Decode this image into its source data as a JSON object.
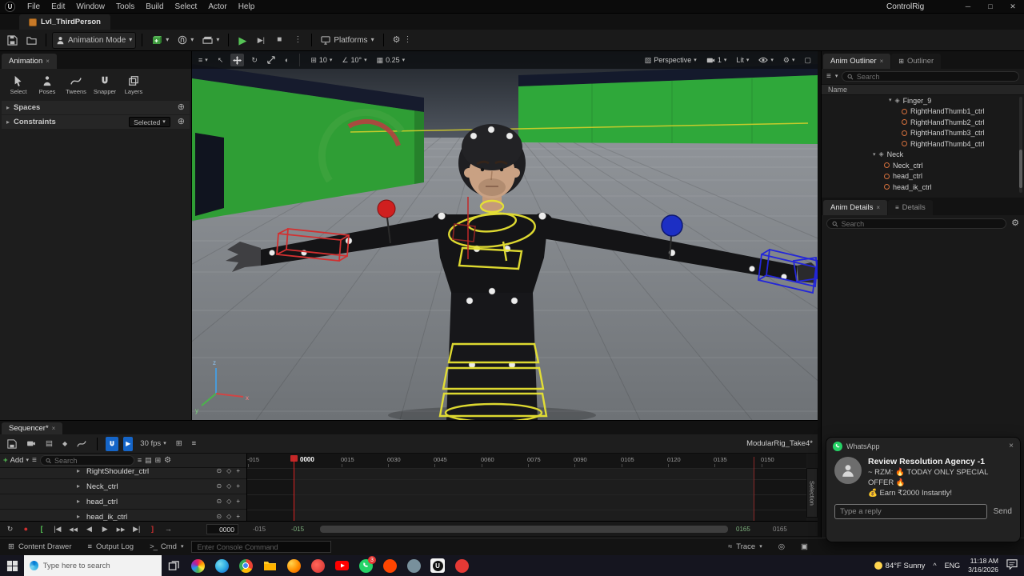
{
  "colors": {
    "accent_blue": "#1565c8",
    "play_green": "#56c356",
    "wall_green": "#2fa238",
    "control_yellow": "#e8e332",
    "control_red": "#d83030",
    "control_blue": "#2430d0",
    "whatsapp_green": "#25d366"
  },
  "menu": {
    "items": [
      "File",
      "Edit",
      "Window",
      "Tools",
      "Build",
      "Select",
      "Actor",
      "Help"
    ],
    "window_title": "ControlRig"
  },
  "tabs": {
    "level_tab": "Lvl_ThirdPerson"
  },
  "toolbar": {
    "mode": "Animation Mode",
    "platforms": "Platforms"
  },
  "anim_panel": {
    "title": "Animation",
    "tools": [
      {
        "label": "Select"
      },
      {
        "label": "Poses"
      },
      {
        "label": "Tweens"
      },
      {
        "label": "Snapper"
      },
      {
        "label": "Layers"
      }
    ],
    "spaces_label": "Spaces",
    "constraints_label": "Constraints",
    "constraints_value": "Selected"
  },
  "viewport": {
    "snap_move": "10",
    "snap_rotate": "10°",
    "snap_scale": "0.25",
    "perspective_label": "Perspective",
    "camera_speed": "1",
    "view_mode_label": "Lit",
    "axis_x": "x",
    "axis_y": "y",
    "axis_z": "z"
  },
  "outliner": {
    "tab_active": "Anim Outliner",
    "tab_inactive": "Outliner",
    "search_placeholder": "Search",
    "name_header": "Name",
    "tree": [
      {
        "label": "Finger_9",
        "type": "group"
      },
      {
        "label": "RightHandThumb1_ctrl",
        "type": "control"
      },
      {
        "label": "RightHandThumb2_ctrl",
        "type": "control"
      },
      {
        "label": "RightHandThumb3_ctrl",
        "type": "control"
      },
      {
        "label": "RightHandThumb4_ctrl",
        "type": "control"
      },
      {
        "label": "Neck",
        "type": "group"
      },
      {
        "label": "Neck_ctrl",
        "type": "control"
      },
      {
        "label": "head_ctrl",
        "type": "control"
      },
      {
        "label": "head_ik_ctrl",
        "type": "control"
      }
    ]
  },
  "details_panel": {
    "tab_active": "Anim Details",
    "tab_inactive": "Details",
    "search_placeholder": "Search"
  },
  "sequencer": {
    "tab_title": "Sequencer*",
    "fps_label": "30 fps",
    "take_name": "ModularRig_Take4*",
    "add_label": "Add",
    "search_placeholder": "Search",
    "tracks": [
      {
        "label": "RightShoulder_ctrl"
      },
      {
        "label": "Neck_ctrl"
      },
      {
        "label": "head_ctrl"
      },
      {
        "label": "head_ik_ctrl"
      }
    ],
    "playhead_label": "0000",
    "ruler_ticks": [
      "-015",
      "0015",
      "0030",
      "0045",
      "0060",
      "0075",
      "0090",
      "0105",
      "0120",
      "0135",
      "0150"
    ],
    "current_frame": "0000",
    "view_start": "-015",
    "range_start": "-015",
    "range_end": "0165",
    "view_end": "0165",
    "selection_tab": "Selection"
  },
  "whatsapp": {
    "app_name": "WhatsApp",
    "chat_title": "Review Resolution Agency -1",
    "message_line1": "~ RZM: 🔥 TODAY ONLY SPECIAL OFFER 🔥",
    "message_line2": "💰 Earn ₹2000 Instantly!",
    "reply_placeholder": "Type a reply",
    "send_label": "Send"
  },
  "status_bar": {
    "content_drawer": "Content Drawer",
    "output_log": "Output Log",
    "cmd_label": "Cmd",
    "console_placeholder": "Enter Console Command",
    "trace_label": "Trace"
  },
  "taskbar": {
    "search_placeholder": "Type here to search",
    "weather": "84°F Sunny",
    "language": "ENG",
    "time": "11:18 AM",
    "date": "3/16/2026",
    "whatsapp_badge": "3"
  }
}
